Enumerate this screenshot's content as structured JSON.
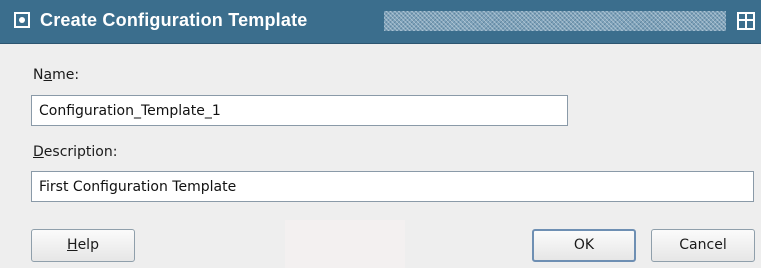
{
  "window": {
    "title": "Create Configuration Template",
    "menu_icon": "window-menu-icon",
    "restore_icon": "window-restore-icon"
  },
  "form": {
    "name": {
      "label_accel": "a",
      "label_pre": "N",
      "label_post": "me:",
      "value": "Configuration_Template_1"
    },
    "description": {
      "label_accel": "D",
      "label_pre": "",
      "label_post": "escription:",
      "value": "First Configuration Template"
    }
  },
  "buttons": {
    "help": {
      "accel": "H",
      "rest": "elp"
    },
    "ok": {
      "label": "OK"
    },
    "cancel": {
      "label": "Cancel"
    }
  },
  "colors": {
    "titlebar": "#3b6e8d",
    "dialog_bg": "#eeeeee",
    "default_button_border": "#6e8fb3"
  }
}
